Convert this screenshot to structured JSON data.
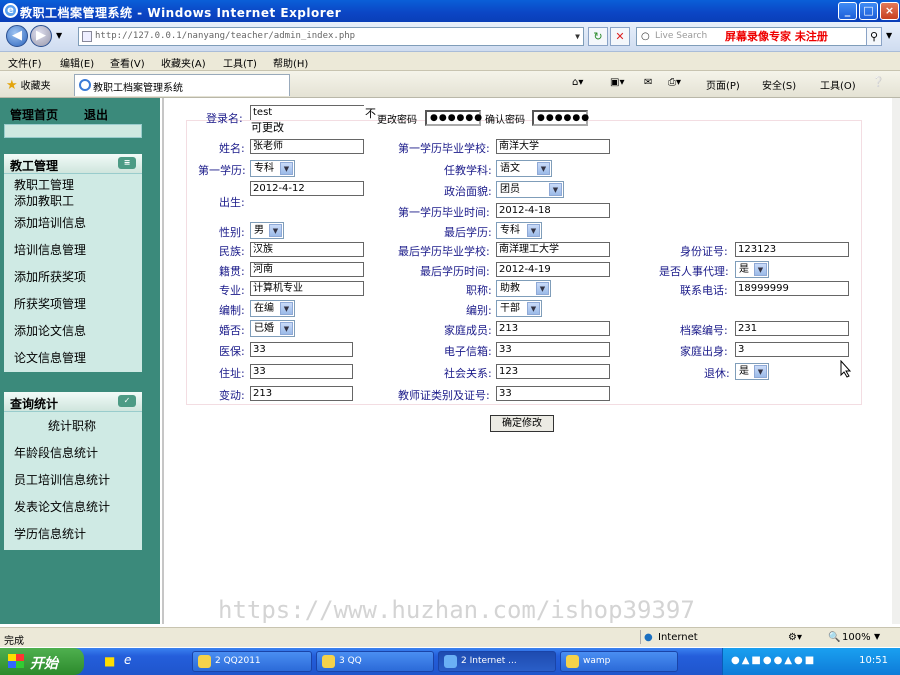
{
  "window": {
    "title": "教职工档案管理系统 - Windows Internet Explorer",
    "min": "_",
    "max": "□",
    "close": "×"
  },
  "browser": {
    "url": "http://127.0.0.1/nanyang/teacher/admin_index.php",
    "search_placeholder": "Live Search",
    "promo": "屏幕录像专家 未注册",
    "menu": [
      "文件(F)",
      "编辑(E)",
      "查看(V)",
      "收藏夹(A)",
      "工具(T)",
      "帮助(H)"
    ],
    "favorites_label": "收藏夹",
    "tab_title": "教职工档案管理系统",
    "tools": [
      "页面(P)",
      "安全(S)",
      "工具(O)"
    ]
  },
  "sidebar": {
    "home": "管理首页",
    "logout": "退出",
    "panels": [
      {
        "title": "教工管理",
        "items": [
          "教职工管理",
          "添加教职工",
          "添加培训信息",
          "培训信息管理",
          "添加所获奖项",
          "所获奖项管理",
          "添加论文信息",
          "论文信息管理"
        ]
      },
      {
        "title": "查询统计",
        "items": [
          "统计职称",
          "年龄段信息统计",
          "员工培训信息统计",
          "发表论文信息统计",
          "学历信息统计"
        ]
      }
    ]
  },
  "form": {
    "login_label": "登录名:",
    "login_value": "test",
    "login_note_1": "不",
    "login_note_2": "可更改",
    "change_pw_label": "更改密码",
    "change_pw_value": "●●●●●●",
    "confirm_pw_label": "确认密码",
    "confirm_pw_value": "●●●●●●",
    "name_label": "姓名:",
    "name_value": "张老师",
    "school1_label": "第一学历毕业学校:",
    "school1_value": "南洋大学",
    "edu1_label": "第一学历:",
    "edu1_value": "专科",
    "subject_label": "任教学科:",
    "subject_value": "语文",
    "birth_label": "出生:",
    "birth_value": "2012-4-12",
    "politics_label": "政治面貌:",
    "politics_value": "团员",
    "grad1_label": "第一学历毕业时间:",
    "grad1_value": "2012-4-18",
    "gender_label": "性别:",
    "gender_value": "男",
    "topedu_label": "最后学历:",
    "topedu_value": "专科",
    "nation_label": "民族:",
    "nation_value": "汉族",
    "topschool_label": "最后学历毕业学校:",
    "topschool_value": "南洋理工大学",
    "idcard_label": "身份证号:",
    "idcard_value": "123123",
    "native_label": "籍贯:",
    "native_value": "河南",
    "topgrad_label": "最后学历时间:",
    "topgrad_value": "2012-4-19",
    "agent_label": "是否人事代理:",
    "agent_value": "是",
    "major_label": "专业:",
    "major_value": "计算机专业",
    "title_label": "职称:",
    "title_value": "助教",
    "phone_label": "联系电话:",
    "phone_value": "18999999",
    "staffing_label": "编制:",
    "staffing_value": "在编",
    "staffing2_label": "编别:",
    "staffing2_value": "干部",
    "marriage_label": "婚否:",
    "marriage_value": "已婚",
    "family_label": "家庭成员:",
    "family_value": "213",
    "archive_label": "档案编号:",
    "archive_value": "231",
    "insurance_label": "医保:",
    "insurance_value": "33",
    "email_label": "电子信箱:",
    "email_value": "33",
    "origin_label": "家庭出身:",
    "origin_value": "3",
    "address_label": "住址:",
    "address_value": "33",
    "social_label": "社会关系:",
    "social_value": "123",
    "retired_label": "退休:",
    "retired_value": "是",
    "change_label": "变动:",
    "change_value": "213",
    "cert_label": "教师证类别及证号:",
    "cert_value": "33",
    "submit": "确定修改"
  },
  "watermark": "https://www.huzhan.com/ishop39397",
  "status": {
    "left": "完成",
    "zone": "Internet",
    "zoom": "100%"
  },
  "taskbar": {
    "start": "开始",
    "tasks": [
      "2 QQ2011",
      "3 QQ",
      "2 Internet ...",
      "wamp"
    ],
    "clock": "10:51"
  },
  "colors": {
    "sidebar": "#3b8a7b",
    "label": "#1b1b8a",
    "titlebar": "#0b45c4"
  }
}
